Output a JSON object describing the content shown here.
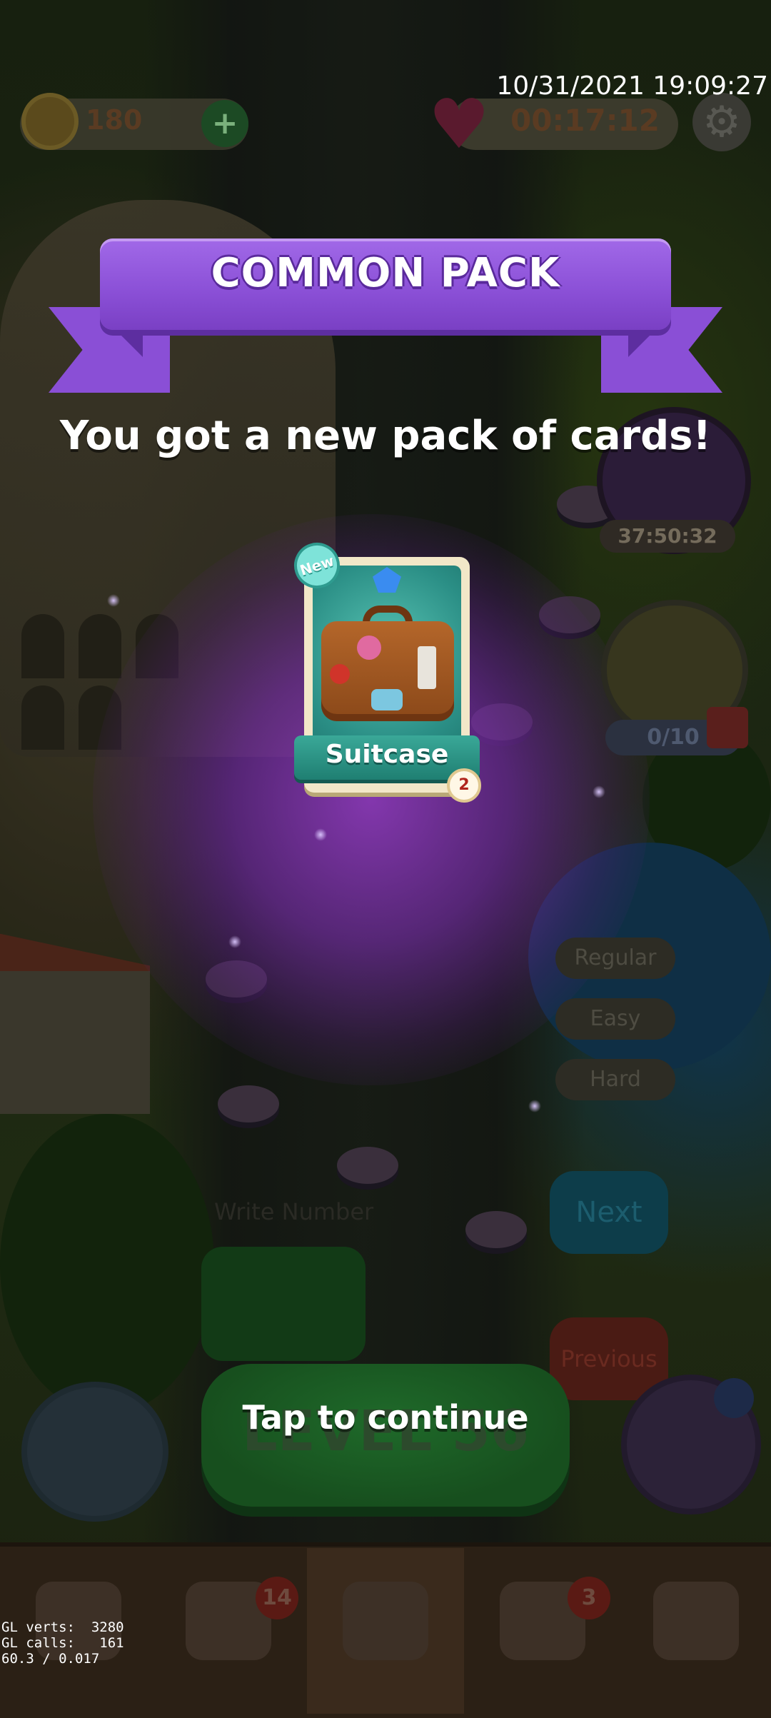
{
  "status": {
    "datetime": "10/31/2021 19:09:27"
  },
  "hud": {
    "coins": "180",
    "lives_timer": "00:17:12",
    "event_timer": "37:50:32",
    "gem_progress": "0/10"
  },
  "map": {
    "difficulty_buttons": [
      "Regular",
      "Easy",
      "Hard"
    ],
    "next_label": "Next",
    "previous_label": "Previous",
    "write_number_label": "Write Number",
    "level_label": "LEVEL 56"
  },
  "dialog": {
    "title": "COMMON PACK",
    "subtitle": "You got a new pack of cards!",
    "card": {
      "name": "Suitcase",
      "badge": "New",
      "count": "2"
    },
    "continue_label": "Tap to continue"
  },
  "bottom_nav": {
    "badges": {
      "mail": "14",
      "friends": "3"
    }
  },
  "debug": {
    "gl_stats": "GL verts:  3280\nGL calls:   161\n60.3 / 0.017"
  },
  "colors": {
    "ribbon": "#8a4fd6",
    "card_teal": "#2b8f86",
    "glow": "#9638c8"
  }
}
